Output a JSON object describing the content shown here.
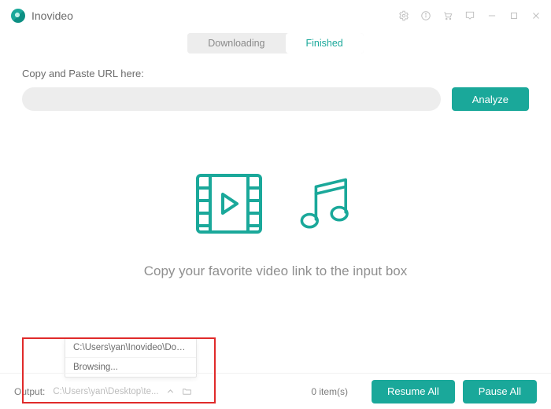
{
  "app": {
    "title": "Inovideo"
  },
  "tabs": {
    "downloading": "Downloading",
    "finished": "Finished",
    "active": "finished"
  },
  "url_section": {
    "label": "Copy and Paste URL here:",
    "value": "",
    "analyze": "Analyze"
  },
  "empty": {
    "message": "Copy your favorite video link to the input box"
  },
  "output": {
    "label": "Output:",
    "path": "C:\\Users\\yan\\Desktop\\te...",
    "popup": {
      "recent": "C:\\Users\\yan\\Inovideo\\Down...",
      "browse": "Browsing..."
    }
  },
  "status": {
    "item_count": "0 item(s)"
  },
  "buttons": {
    "resume": "Resume All",
    "pause": "Pause All"
  },
  "colors": {
    "accent": "#1aa89a"
  }
}
